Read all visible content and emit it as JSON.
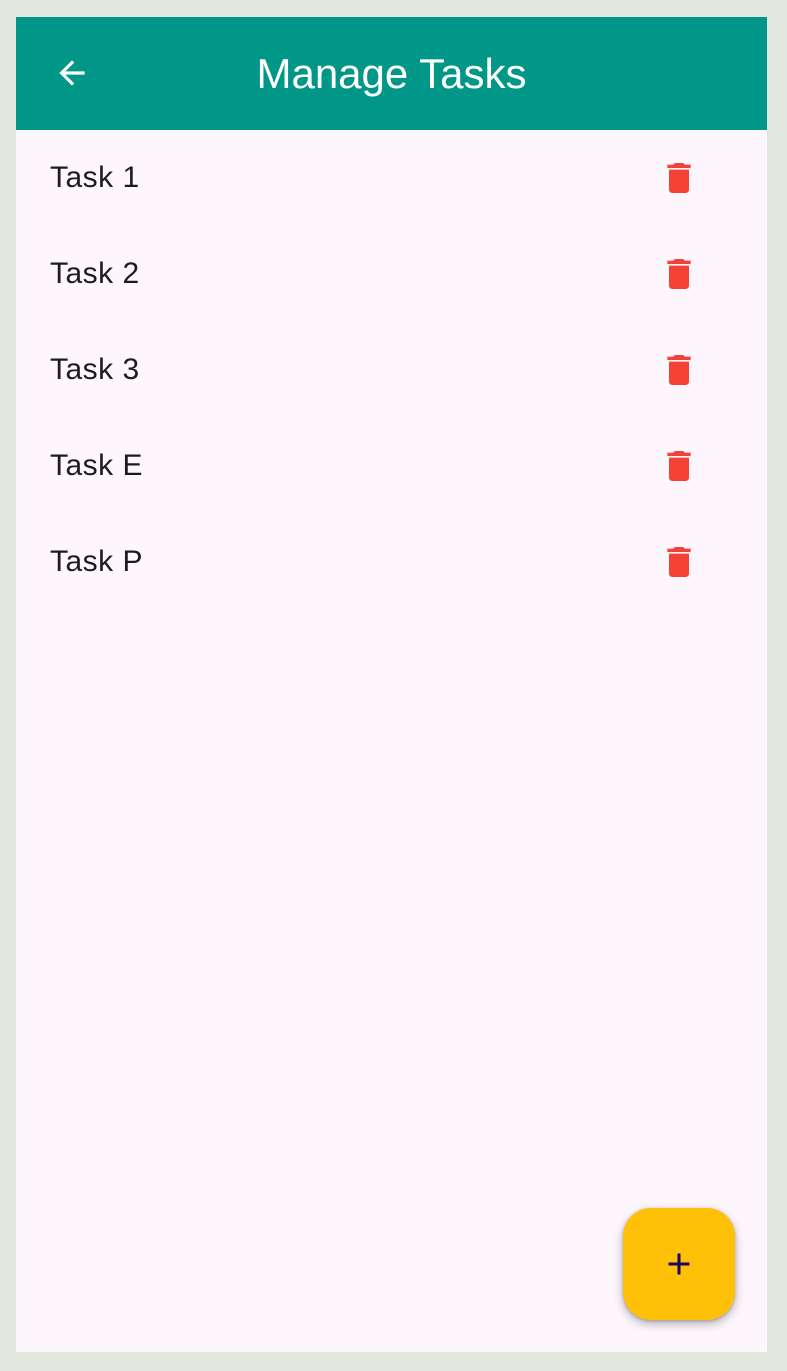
{
  "appbar": {
    "title": "Manage Tasks",
    "back_icon": "arrow-back-icon",
    "color": "#009688"
  },
  "tasks": [
    {
      "label": "Task 1",
      "action_icon": "delete-icon"
    },
    {
      "label": "Task 2",
      "action_icon": "delete-icon"
    },
    {
      "label": "Task 3",
      "action_icon": "delete-icon"
    },
    {
      "label": "Task E",
      "action_icon": "delete-icon"
    },
    {
      "label": "Task P",
      "action_icon": "delete-icon"
    }
  ],
  "fab": {
    "icon": "add-icon",
    "color": "#ffc107"
  },
  "colors": {
    "delete": "#f44336",
    "background": "#fdf7fd"
  }
}
